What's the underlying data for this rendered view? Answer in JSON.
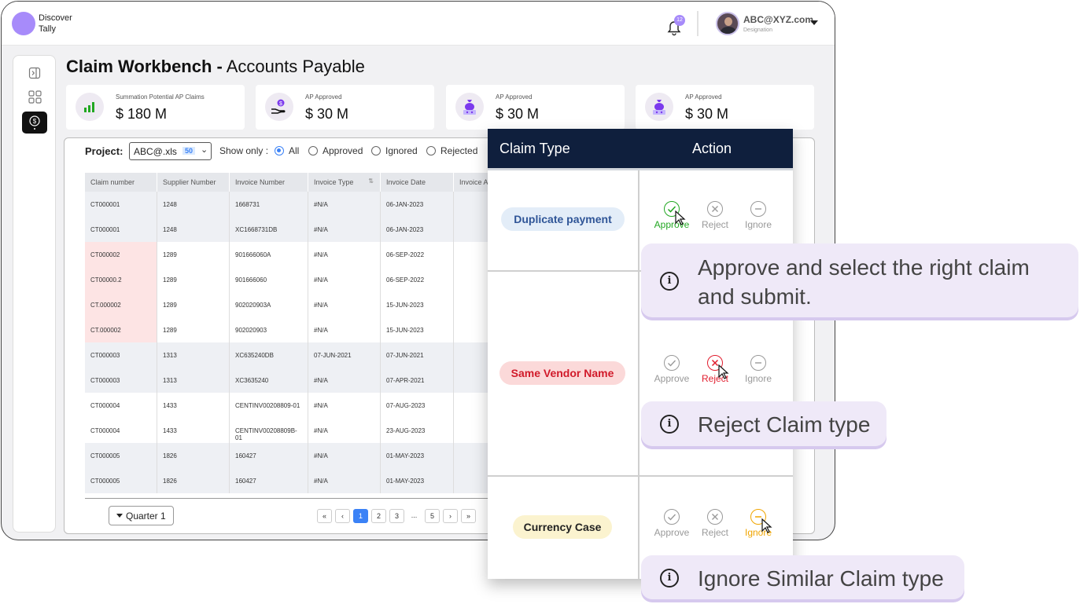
{
  "app": {
    "title_line1": "Discover",
    "title_line2": "Tally"
  },
  "header": {
    "notification_count": "12",
    "user_email": "ABC@XYZ.com",
    "user_role": "Designation"
  },
  "page": {
    "title_bold": "Claim Workbench -",
    "title_rest": " Accounts Payable"
  },
  "kpis": [
    {
      "label": "Summation Potential AP Claims",
      "value": "$ 180 M",
      "icon": "bar-chart-icon"
    },
    {
      "label": "AP Approved",
      "value": "$ 30 M",
      "icon": "hand-coin-icon"
    },
    {
      "label": "AP Approved",
      "value": "$ 30 M",
      "icon": "money-bag-icon"
    },
    {
      "label": "AP Approved",
      "value": "$ 30 M",
      "icon": "money-bag-icon"
    }
  ],
  "filters": {
    "project_label": "Project:",
    "project_value": "ABC@.xls",
    "project_count": "50",
    "show_only_label": "Show only :",
    "options": [
      "All",
      "Approved",
      "Ignored",
      "Rejected"
    ],
    "selected": "All"
  },
  "table": {
    "columns": [
      "Claim number",
      "Supplier Number",
      "Invoice Number",
      "Invoice Type",
      "Invoice Date",
      "Invoice A"
    ],
    "rows": [
      [
        "CT000001",
        "1248",
        "1668731",
        "#N/A",
        "06-JAN-2023"
      ],
      [
        "CT000001",
        "1248",
        "XC1668731DB",
        "#N/A",
        "06-JAN-2023"
      ],
      [
        "CT000002",
        "1289",
        "901666060A",
        "#N/A",
        "06-SEP-2022"
      ],
      [
        "CT00000.2",
        "1289",
        "901666060",
        "#N/A",
        "06-SEP-2022"
      ],
      [
        "CT.000002",
        "1289",
        "902020903A",
        "#N/A",
        "15-JUN-2023"
      ],
      [
        "CT.000002",
        "1289",
        "902020903",
        "#N/A",
        "15-JUN-2023"
      ],
      [
        "CT000003",
        "1313",
        "XC635240DB",
        "07-JUN-2021",
        "07-JUN-2021"
      ],
      [
        "CT000003",
        "1313",
        "XC3635240",
        "#N/A",
        "07-APR-2021"
      ],
      [
        "CT000004",
        "1433",
        "CENTINV00208809-01",
        "#N/A",
        "07-AUG-2023"
      ],
      [
        "CT000004",
        "1433",
        "CENTINV00208809B-01",
        "#N/A",
        "23-AUG-2023"
      ],
      [
        "CT000005",
        "1826",
        "160427",
        "#N/A",
        "01-MAY-2023"
      ],
      [
        "CT000005",
        "1826",
        "160427",
        "#N/A",
        "01-MAY-2023"
      ]
    ]
  },
  "pagination": {
    "quarter": "Quarter 1",
    "first": "«",
    "prev": "‹",
    "pages": [
      "1",
      "2",
      "3"
    ],
    "ellipsis": "...",
    "last_page": "5",
    "next": "›",
    "last": "»",
    "current": "1"
  },
  "claim_panel": {
    "col_type": "Claim Type",
    "col_action": "Action",
    "actions": [
      "Approve",
      "Reject",
      "Ignore"
    ],
    "claims": [
      {
        "type": "Duplicate payment",
        "selected": "Approve"
      },
      {
        "type": "Same Vendor Name",
        "selected": "Reject"
      },
      {
        "type": "Currency Case",
        "selected": "Ignore"
      }
    ]
  },
  "tips": [
    "Approve and select the right claim and submit.",
    "Reject Claim type",
    "Ignore Similar Claim type"
  ],
  "colors": {
    "accent": "#a78bfa",
    "navy": "#0f1f3d",
    "approve": "#22a722",
    "reject": "#e11d2e",
    "ignore": "#f0a500",
    "link": "#3b82f6"
  }
}
